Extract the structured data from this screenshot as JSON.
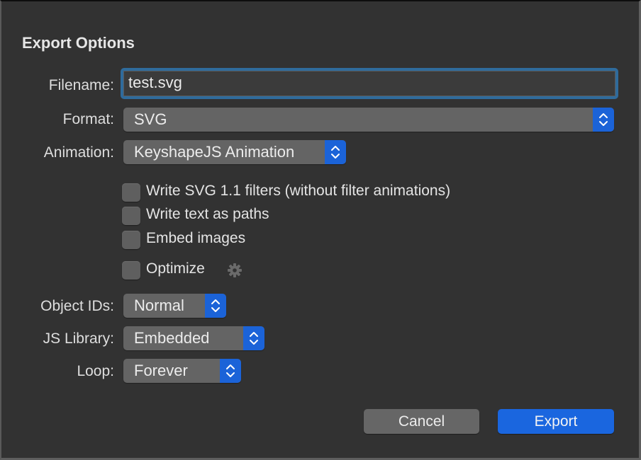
{
  "dialog": {
    "title": "Export Options"
  },
  "filename": {
    "label": "Filename:",
    "value": "test.svg"
  },
  "format": {
    "label": "Format:",
    "selected": "SVG"
  },
  "animation": {
    "label": "Animation:",
    "selected": "KeyshapeJS Animation"
  },
  "checkboxes": [
    {
      "label": "Write SVG 1.1 filters (without filter animations)",
      "checked": false
    },
    {
      "label": "Write text as paths",
      "checked": false
    },
    {
      "label": "Embed images",
      "checked": false
    },
    {
      "label": "Optimize",
      "checked": false
    }
  ],
  "optimize_settings_icon": "gear-icon",
  "object_ids": {
    "label": "Object IDs:",
    "selected": "Normal"
  },
  "js_library": {
    "label": "JS Library:",
    "selected": "Embedded"
  },
  "loop": {
    "label": "Loop:",
    "selected": "Forever"
  },
  "buttons": {
    "cancel": "Cancel",
    "export": "Export"
  },
  "colors": {
    "accent": "#1a66df",
    "focus_ring": "#2f6b9c",
    "background": "#323232"
  }
}
